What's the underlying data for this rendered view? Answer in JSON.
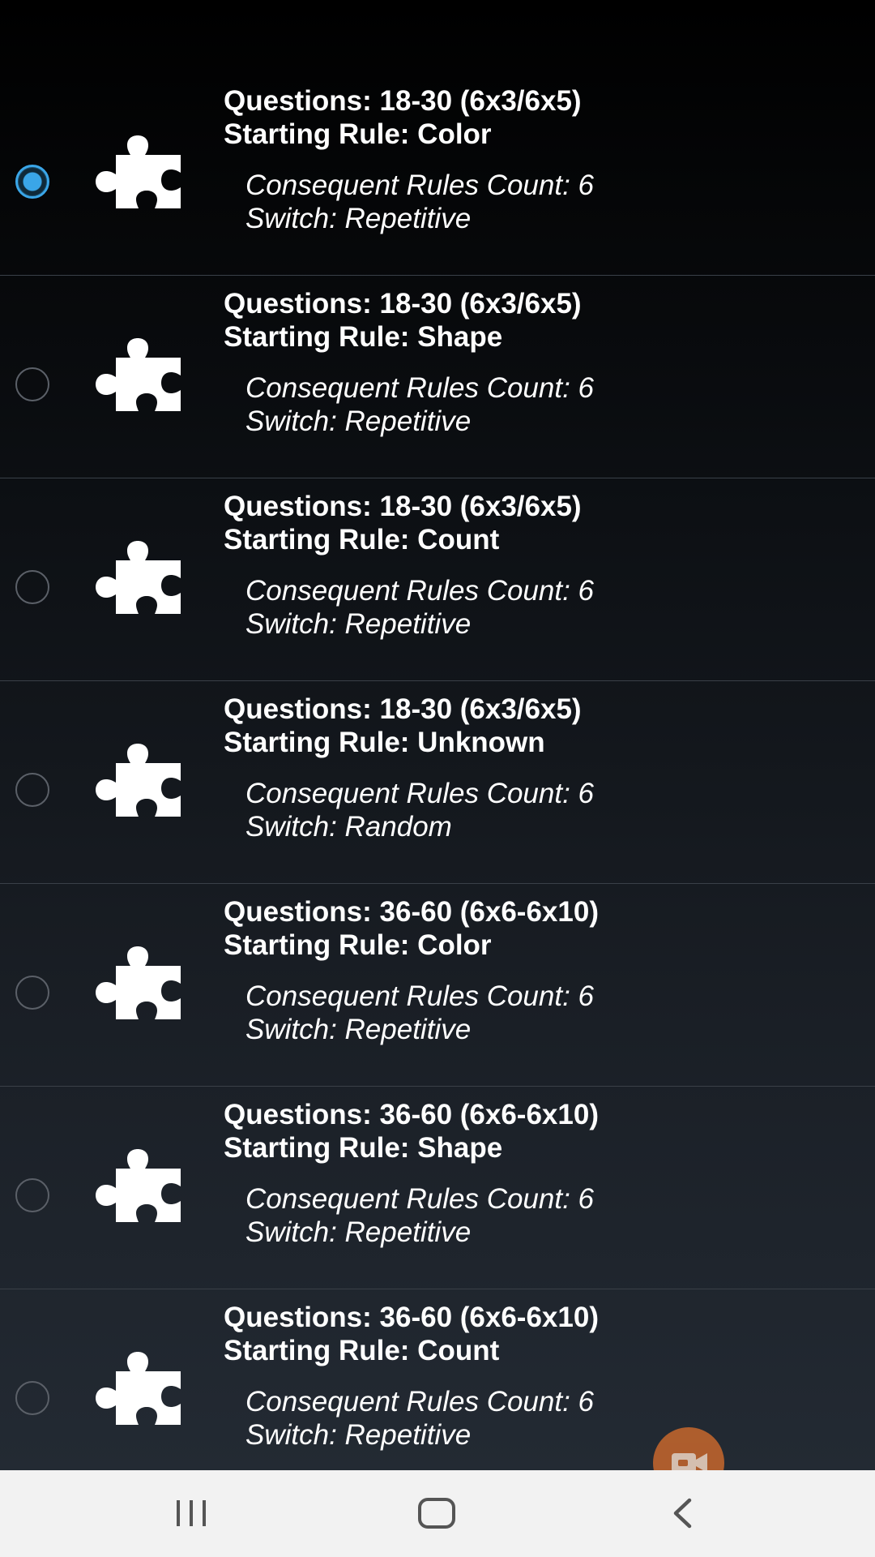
{
  "rows": [
    {
      "questions": "Questions: 18-30 (6x3/6x5)",
      "starting_rule": "Starting Rule: Color",
      "consequent": "Consequent Rules Count: 6",
      "switch": "Switch: Repetitive",
      "selected": true
    },
    {
      "questions": "Questions: 18-30 (6x3/6x5)",
      "starting_rule": "Starting Rule: Shape",
      "consequent": "Consequent Rules Count: 6",
      "switch": "Switch: Repetitive",
      "selected": false
    },
    {
      "questions": "Questions: 18-30 (6x3/6x5)",
      "starting_rule": "Starting Rule: Count",
      "consequent": "Consequent Rules Count: 6",
      "switch": "Switch: Repetitive",
      "selected": false
    },
    {
      "questions": "Questions: 18-30 (6x3/6x5)",
      "starting_rule": "Starting Rule: Unknown",
      "consequent": "Consequent Rules Count: 6",
      "switch": "Switch: Random",
      "selected": false
    },
    {
      "questions": "Questions: 36-60 (6x6-6x10)",
      "starting_rule": "Starting Rule: Color",
      "consequent": "Consequent Rules Count: 6",
      "switch": "Switch: Repetitive",
      "selected": false
    },
    {
      "questions": "Questions: 36-60 (6x6-6x10)",
      "starting_rule": "Starting Rule: Shape",
      "consequent": "Consequent Rules Count: 6",
      "switch": "Switch: Repetitive",
      "selected": false
    },
    {
      "questions": "Questions: 36-60 (6x6-6x10)",
      "starting_rule": "Starting Rule: Count",
      "consequent": "Consequent Rules Count: 6",
      "switch": "Switch: Repetitive",
      "selected": false
    }
  ],
  "icons": {
    "row_icon": "puzzle-piece-icon",
    "fab_icon": "video-camera-icon",
    "nav_recents": "recent-apps-icon",
    "nav_home": "home-icon",
    "nav_back": "back-icon"
  },
  "colors": {
    "radio_selected": "#3aa6e8",
    "fab": "#c7672d",
    "navbar": "#f2f2f2"
  }
}
